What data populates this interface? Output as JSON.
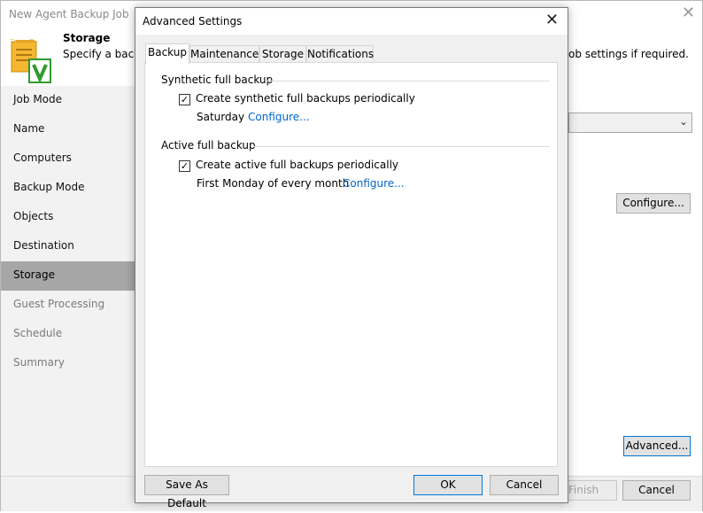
{
  "wizard": {
    "title": "New Agent Backup Job",
    "header": {
      "title": "Storage",
      "description_start": "Specify a backu",
      "description_end": "ob settings if required."
    },
    "nav": [
      {
        "label": "Job Mode",
        "state": "normal"
      },
      {
        "label": "Name",
        "state": "normal"
      },
      {
        "label": "Computers",
        "state": "normal"
      },
      {
        "label": "Backup Mode",
        "state": "normal"
      },
      {
        "label": "Objects",
        "state": "normal"
      },
      {
        "label": "Destination",
        "state": "normal"
      },
      {
        "label": "Storage",
        "state": "selected"
      },
      {
        "label": "Guest Processing",
        "state": "dim"
      },
      {
        "label": "Schedule",
        "state": "dim"
      },
      {
        "label": "Summary",
        "state": "dim"
      }
    ],
    "configure_label": "Configure...",
    "advanced_label": "Advanced...",
    "finish_label": "Finish",
    "cancel_label": "Cancel"
  },
  "dialog": {
    "title": "Advanced Settings",
    "tabs": [
      {
        "label": "Backup",
        "active": true
      },
      {
        "label": "Maintenance",
        "active": false
      },
      {
        "label": "Storage",
        "active": false
      },
      {
        "label": "Notifications",
        "active": false
      }
    ],
    "synthetic": {
      "group_label": "Synthetic full backup",
      "checkbox_label": "Create synthetic full backups periodically",
      "checked": true,
      "schedule_text": "Saturday",
      "configure_label": "Configure..."
    },
    "active": {
      "group_label": "Active full backup",
      "checkbox_label": "Create active full backups periodically",
      "checked": true,
      "schedule_text": "First Monday of every month",
      "configure_label": "Configure..."
    },
    "buttons": {
      "save_default": "Save As Default",
      "ok": "OK",
      "cancel": "Cancel"
    }
  },
  "colors": {
    "link": "#0066cc",
    "nav_selected": "#a6a6a6",
    "focus_border": "#0078d7",
    "icon_green": "#2e9b2e",
    "icon_yellow": "#f5b731"
  }
}
